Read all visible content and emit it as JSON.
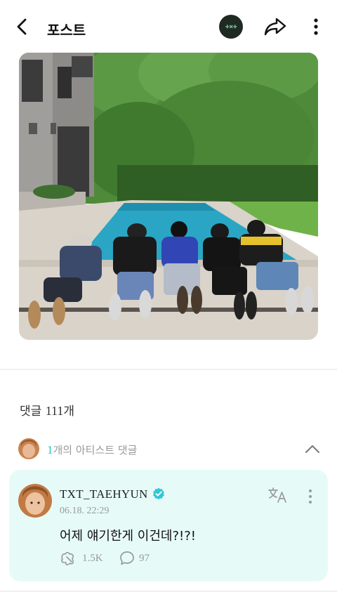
{
  "header": {
    "title": "포스트",
    "group_logo_text": "+×+",
    "icons": [
      "back-arrow-icon",
      "share-icon",
      "more-vertical-icon"
    ]
  },
  "post": {
    "image_alt": "Five members lying on pool deck facing pool"
  },
  "comments": {
    "count_prefix": "댓글 ",
    "count_number": "111",
    "count_suffix": "개",
    "artist_comments": {
      "count": "1",
      "label": "개의 아티스트 댓글",
      "expanded": true
    },
    "items": [
      {
        "author": "TXT_TAEHYUN",
        "verified": true,
        "timestamp": "06.18. 22:29",
        "text": "어제 얘기한게 이건데?!?!",
        "likes": "1.5K",
        "replies": "97"
      }
    ]
  },
  "colors": {
    "accent": "#21c6c6",
    "verified": "#33c7d6",
    "card_bg": "#e6fbf7"
  }
}
